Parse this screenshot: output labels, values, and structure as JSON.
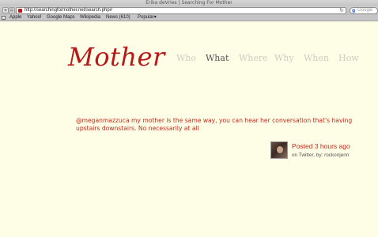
{
  "window": {
    "title": "Erika deVries | Searching For Mother"
  },
  "toolbar": {
    "back_label": "+",
    "url": "http://searchingformother.net/search.php#",
    "reload_icon": "reload-icon",
    "search_placeholder": "Google",
    "search_engine_glyph": "g"
  },
  "bookmarks": {
    "items": [
      "Apple",
      "Yahoo!",
      "Google Maps",
      "Wikipedia",
      "News (610)",
      "Popular"
    ]
  },
  "site": {
    "logo": "Mother",
    "nav": [
      "Who",
      "What",
      "Where",
      "Why",
      "When",
      "How"
    ],
    "active_nav": "What",
    "brand_color": "#b71818",
    "background_color": "#fefde6"
  },
  "post": {
    "text": "@meganmazzuca my mother is the same way, you can hear her conversation that's having upstairs downstairs. No necessarily at all",
    "posted": "Posted 3 hours ago",
    "meta": "on Twitter, by: rockonjenn"
  }
}
